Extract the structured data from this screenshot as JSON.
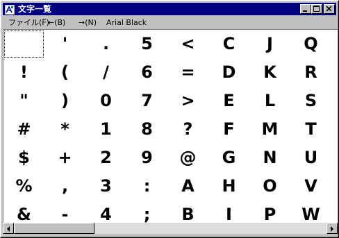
{
  "window": {
    "title": "文字一覧",
    "controls": [
      "minimize-icon",
      "maximize-icon",
      "close-icon"
    ]
  },
  "menu": {
    "items": [
      "ファイル(F)",
      "←(B)",
      "→(N)",
      "Arial Black"
    ]
  },
  "glyphs": {
    "selected_index": 0,
    "columns": [
      [
        "",
        "!",
        "\"",
        "#",
        "$",
        "%",
        "&"
      ],
      [
        "'",
        "(",
        ")",
        "*",
        "+",
        ",",
        "-"
      ],
      [
        ".",
        "/",
        "0",
        "1",
        "2",
        "3",
        "4"
      ],
      [
        "5",
        "6",
        "7",
        "8",
        "9",
        ":",
        ";"
      ],
      [
        "<",
        "=",
        ">",
        "?",
        "@",
        "A",
        "B"
      ],
      [
        "C",
        "D",
        "E",
        "F",
        "G",
        "H",
        "I"
      ],
      [
        "J",
        "K",
        "L",
        "M",
        "N",
        "O",
        "P"
      ],
      [
        "Q",
        "R",
        "S",
        "T",
        "U",
        "V",
        "W"
      ]
    ]
  },
  "colors": {
    "titlebar": "#000080",
    "face": "#c0c0c0",
    "client": "#ffffff"
  }
}
